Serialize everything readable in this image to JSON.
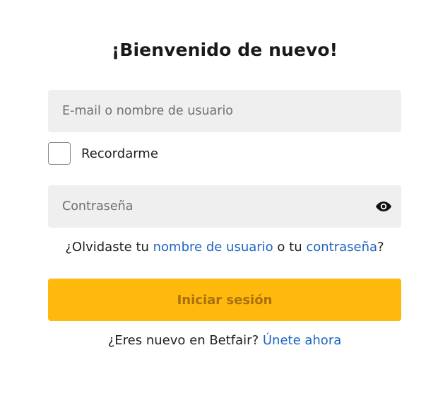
{
  "title": "¡Bienvenido de nuevo!",
  "login": {
    "email_placeholder": "E-mail o nombre de usuario",
    "email_value": "",
    "remember_label": "Recordarme",
    "remember_checked": false,
    "password_placeholder": "Contraseña",
    "password_value": "",
    "show_password_icon": "eye-icon"
  },
  "forgot": {
    "prefix": "¿Olvidaste tu ",
    "username_link": "nombre de usuario",
    "middle": " o tu ",
    "password_link": "contraseña",
    "suffix": "?"
  },
  "submit_label": "Iniciar sesión",
  "signup": {
    "prefix": "¿Eres nuevo en Betfair? ",
    "link": "Únete ahora"
  },
  "colors": {
    "button_bg": "#ffb80c",
    "button_text": "#a86f10",
    "link": "#1d64c1",
    "field_bg": "#efefef"
  }
}
